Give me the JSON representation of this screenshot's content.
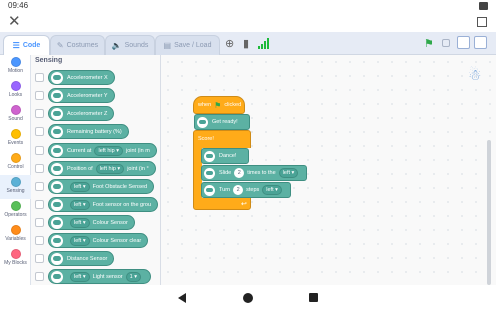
{
  "status": {
    "time": "09:46"
  },
  "tabs": [
    {
      "label": "Code",
      "icon": "code-icon"
    },
    {
      "label": "Costumes",
      "icon": "brush-icon"
    },
    {
      "label": "Sounds",
      "icon": "speaker-icon"
    },
    {
      "label": "Save / Load",
      "icon": "folder-icon"
    }
  ],
  "categories": [
    {
      "label": "Motion",
      "color": "#4c97ff"
    },
    {
      "label": "Looks",
      "color": "#9966ff"
    },
    {
      "label": "Sound",
      "color": "#cf63cf"
    },
    {
      "label": "Events",
      "color": "#ffbf00"
    },
    {
      "label": "Control",
      "color": "#ffab19"
    },
    {
      "label": "Sensing",
      "color": "#5cb1d6"
    },
    {
      "label": "Operators",
      "color": "#59c059"
    },
    {
      "label": "Variables",
      "color": "#ff8c1a"
    },
    {
      "label": "My Blocks",
      "color": "#ff6680"
    }
  ],
  "palette": {
    "title": "Sensing",
    "blocks": [
      {
        "label": "Accelerometer X"
      },
      {
        "label": "Accelerometer Y"
      },
      {
        "label": "Accelerometer Z"
      },
      {
        "label": "Remaining battery (%)"
      },
      {
        "pre": "Current at",
        "dd": "left hip",
        "post": "joint (in m"
      },
      {
        "pre": "Position of",
        "dd": "left hip",
        "post": "joint (in °"
      },
      {
        "dd": "left",
        "post": "Foot Obstacle Sensed"
      },
      {
        "dd": "left",
        "post": "Foot sensor on the grou"
      },
      {
        "dd": "left",
        "post": "Colour Sensor"
      },
      {
        "dd": "left",
        "post": "Colour Sensor  clear"
      },
      {
        "label": "Distance Sensor"
      },
      {
        "dd": "left",
        "post": "Light sensor",
        "dd2": "1"
      }
    ]
  },
  "script": {
    "hat": "when",
    "hat_suffix": "clicked",
    "get_ready": "Get ready!",
    "c_label": "Score!",
    "dance": "Dance!",
    "slide_pre": "Slide",
    "slide_num": "2",
    "slide_mid": "times to the",
    "slide_dir": "left",
    "turn_pre": "Turn",
    "turn_num": "2",
    "turn_mid": "steps",
    "turn_dir": "left"
  }
}
